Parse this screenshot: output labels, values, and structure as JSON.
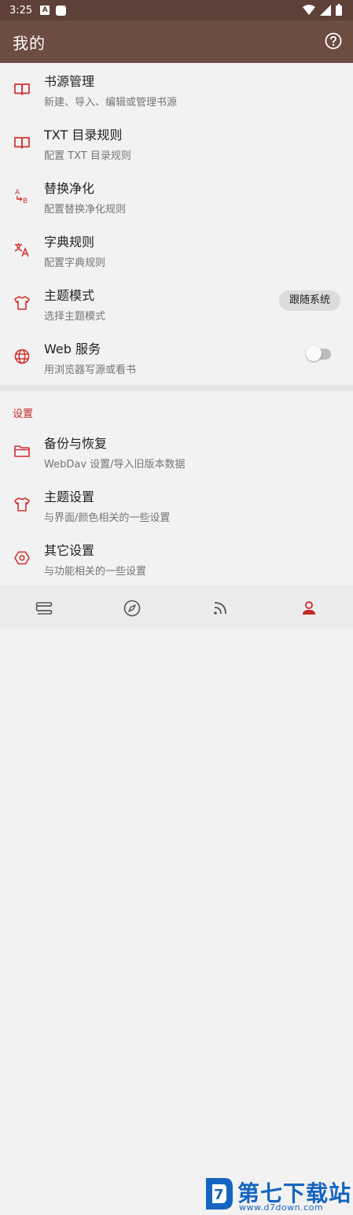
{
  "status_bar": {
    "time": "3:25",
    "notification_icon_letter": "A"
  },
  "app_bar": {
    "title": "我的",
    "help_icon": "help-circle-icon"
  },
  "accent_color": "#d32f2f",
  "bar_color": "#6d4c41",
  "items": [
    {
      "title": "书源管理",
      "subtitle": "新建、导入、编辑或管理书源",
      "icon": "book-open-icon"
    },
    {
      "title": "TXT 目录规则",
      "subtitle": "配置 TXT 目录规则",
      "icon": "book-open-icon"
    },
    {
      "title": "替换净化",
      "subtitle": "配置替换净化规则",
      "icon": "replace-ab-icon"
    },
    {
      "title": "字典规则",
      "subtitle": "配置字典规则",
      "icon": "translate-icon"
    },
    {
      "title": "主题模式",
      "subtitle": "选择主题模式",
      "icon": "tshirt-icon",
      "value": "跟随系统"
    },
    {
      "title": "Web 服务",
      "subtitle": "用浏览器写源或看书",
      "icon": "globe-icon",
      "toggle": false
    }
  ],
  "settings": {
    "header": "设置",
    "items": [
      {
        "title": "备份与恢复",
        "subtitle": "WebDav 设置/导入旧版本数据",
        "icon": "folder-icon"
      },
      {
        "title": "主题设置",
        "subtitle": "与界面/颜色相关的一些设置",
        "icon": "tshirt-icon"
      },
      {
        "title": "其它设置",
        "subtitle": "与功能相关的一些设置",
        "icon": "settings-hexagon-icon"
      }
    ]
  },
  "bottom_nav": [
    {
      "icon": "bookshelf-icon"
    },
    {
      "icon": "compass-icon"
    },
    {
      "icon": "rss-icon"
    },
    {
      "icon": "person-icon"
    }
  ],
  "watermark": {
    "title": "第七下载站",
    "url": "www.d7down.com"
  }
}
